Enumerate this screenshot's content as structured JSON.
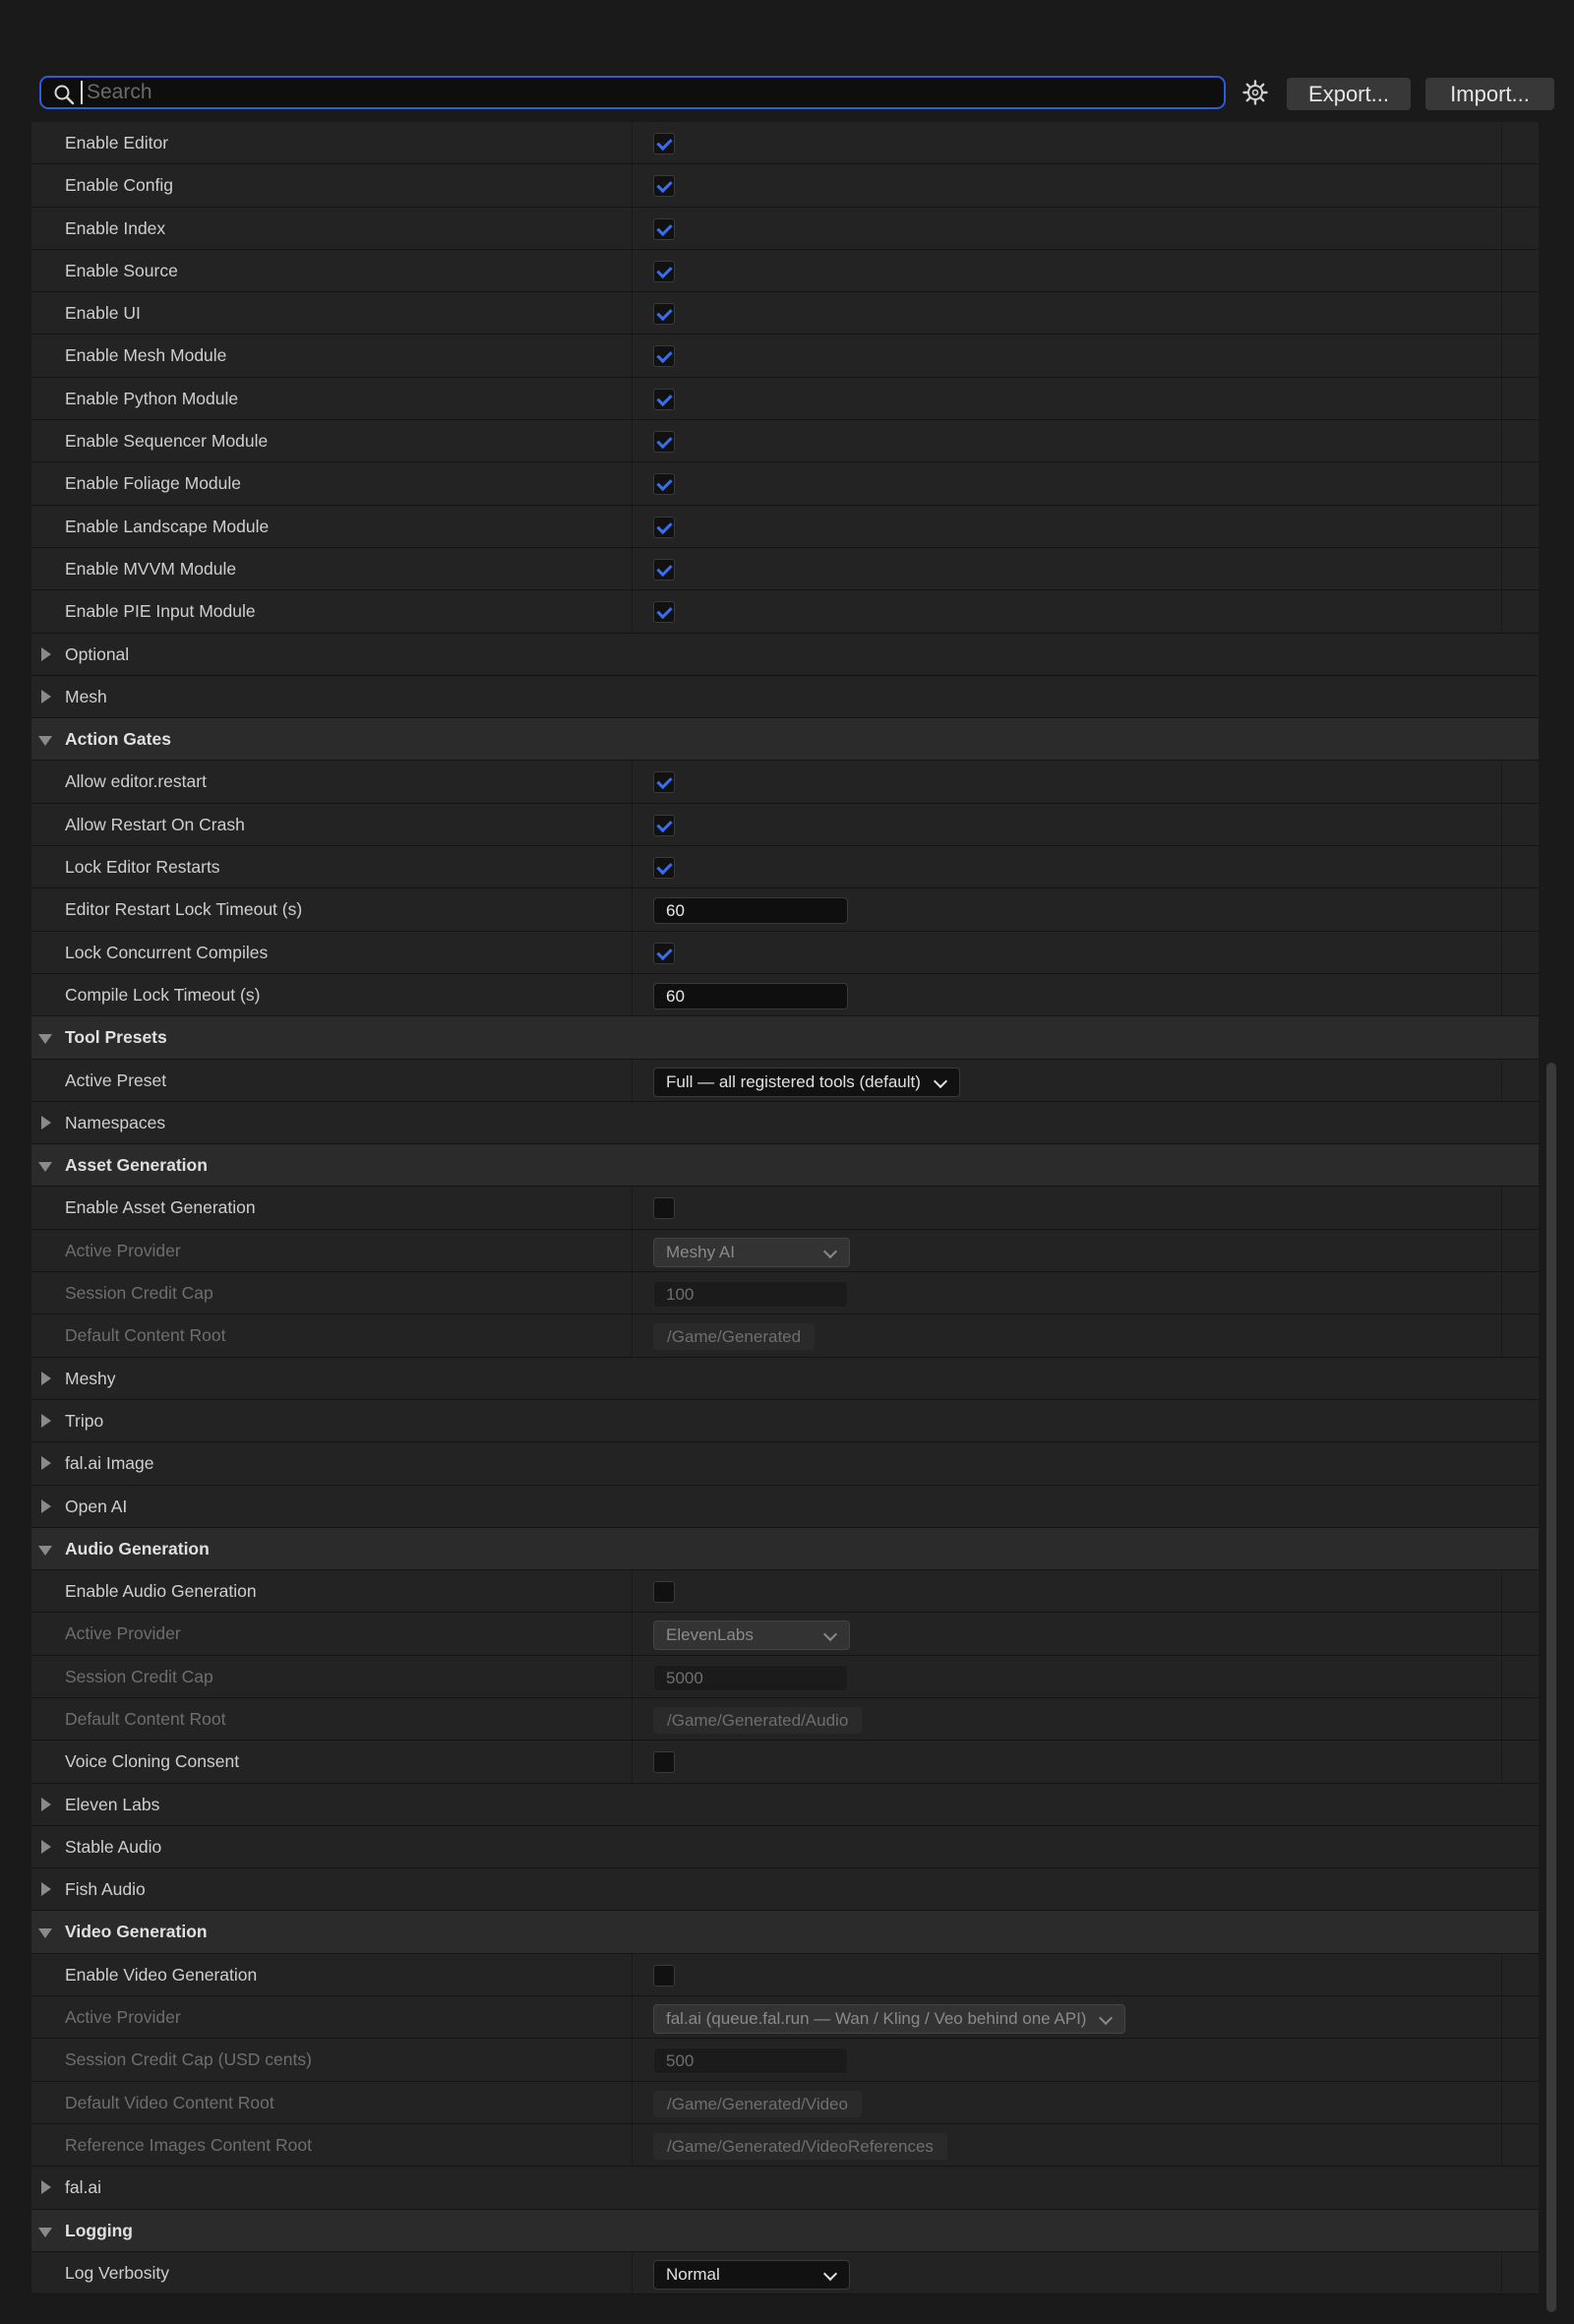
{
  "toolbar": {
    "search_placeholder": "Search",
    "export_label": "Export...",
    "import_label": "Import...",
    "icons": {
      "search": "search-icon",
      "settings": "gear-icon"
    }
  },
  "colors": {
    "accent": "#2e5bd6",
    "check": "#3a6ef0",
    "background": "#1a1a1a"
  },
  "rows": [
    {
      "label": "Enable Editor",
      "kind": "check",
      "checked": true
    },
    {
      "label": "Enable Config",
      "kind": "check",
      "checked": true
    },
    {
      "label": "Enable Index",
      "kind": "check",
      "checked": true
    },
    {
      "label": "Enable Source",
      "kind": "check",
      "checked": true
    },
    {
      "label": "Enable UI",
      "kind": "check",
      "checked": true
    },
    {
      "label": "Enable Mesh Module",
      "kind": "check",
      "checked": true
    },
    {
      "label": "Enable Python Module",
      "kind": "check",
      "checked": true
    },
    {
      "label": "Enable Sequencer Module",
      "kind": "check",
      "checked": true
    },
    {
      "label": "Enable Foliage Module",
      "kind": "check",
      "checked": true
    },
    {
      "label": "Enable Landscape Module",
      "kind": "check",
      "checked": true
    },
    {
      "label": "Enable MVVM Module",
      "kind": "check",
      "checked": true
    },
    {
      "label": "Enable PIE Input Module",
      "kind": "check",
      "checked": true
    },
    {
      "label": "Optional",
      "kind": "group",
      "expanded": false
    },
    {
      "label": "Mesh",
      "kind": "group",
      "expanded": false
    },
    {
      "label": "Action Gates",
      "kind": "category",
      "expanded": true
    },
    {
      "label": "Allow editor.restart",
      "kind": "check",
      "checked": true
    },
    {
      "label": "Allow Restart On Crash",
      "kind": "check",
      "checked": true
    },
    {
      "label": "Lock Editor Restarts",
      "kind": "check",
      "checked": true
    },
    {
      "label": "Editor Restart Lock Timeout (s)",
      "kind": "number",
      "value": "60"
    },
    {
      "label": "Lock Concurrent Compiles",
      "kind": "check",
      "checked": true
    },
    {
      "label": "Compile Lock Timeout (s)",
      "kind": "number",
      "value": "60"
    },
    {
      "label": "Tool Presets",
      "kind": "category",
      "expanded": true
    },
    {
      "label": "Active Preset",
      "kind": "dropdown",
      "value": "Full — all registered tools (default)"
    },
    {
      "label": "Namespaces",
      "kind": "group",
      "expanded": false
    },
    {
      "label": "Asset Generation",
      "kind": "category",
      "expanded": true
    },
    {
      "label": "Enable Asset Generation",
      "kind": "check",
      "checked": false
    },
    {
      "label": "Active Provider",
      "kind": "dropdown",
      "value": "Meshy AI",
      "disabled": true
    },
    {
      "label": "Session Credit Cap",
      "kind": "number",
      "value": "100",
      "disabled": true
    },
    {
      "label": "Default Content Root",
      "kind": "path",
      "value": "/Game/Generated",
      "disabled": true
    },
    {
      "label": "Meshy",
      "kind": "group",
      "expanded": false
    },
    {
      "label": "Tripo",
      "kind": "group",
      "expanded": false
    },
    {
      "label": "fal.ai Image",
      "kind": "group",
      "expanded": false
    },
    {
      "label": "Open AI",
      "kind": "group",
      "expanded": false
    },
    {
      "label": "Audio Generation",
      "kind": "category",
      "expanded": true
    },
    {
      "label": "Enable Audio Generation",
      "kind": "check",
      "checked": false
    },
    {
      "label": "Active Provider",
      "kind": "dropdown",
      "value": "ElevenLabs",
      "disabled": true
    },
    {
      "label": "Session Credit Cap",
      "kind": "number",
      "value": "5000",
      "disabled": true
    },
    {
      "label": "Default Content Root",
      "kind": "path",
      "value": "/Game/Generated/Audio",
      "disabled": true
    },
    {
      "label": "Voice Cloning Consent",
      "kind": "check",
      "checked": false
    },
    {
      "label": "Eleven Labs",
      "kind": "group",
      "expanded": false
    },
    {
      "label": "Stable Audio",
      "kind": "group",
      "expanded": false
    },
    {
      "label": "Fish Audio",
      "kind": "group",
      "expanded": false
    },
    {
      "label": "Video Generation",
      "kind": "category",
      "expanded": true
    },
    {
      "label": "Enable Video Generation",
      "kind": "check",
      "checked": false
    },
    {
      "label": "Active Provider",
      "kind": "dropdown",
      "value": "fal.ai (queue.fal.run — Wan / Kling / Veo behind one API)",
      "disabled": true
    },
    {
      "label": "Session Credit Cap (USD cents)",
      "kind": "number",
      "value": "500",
      "disabled": true
    },
    {
      "label": "Default Video Content Root",
      "kind": "path",
      "value": "/Game/Generated/Video",
      "disabled": true
    },
    {
      "label": "Reference Images Content Root",
      "kind": "path",
      "value": "/Game/Generated/VideoReferences",
      "disabled": true
    },
    {
      "label": "fal.ai",
      "kind": "group",
      "expanded": false
    },
    {
      "label": "Logging",
      "kind": "category",
      "expanded": true
    },
    {
      "label": "Log Verbosity",
      "kind": "dropdown",
      "value": "Normal"
    }
  ]
}
